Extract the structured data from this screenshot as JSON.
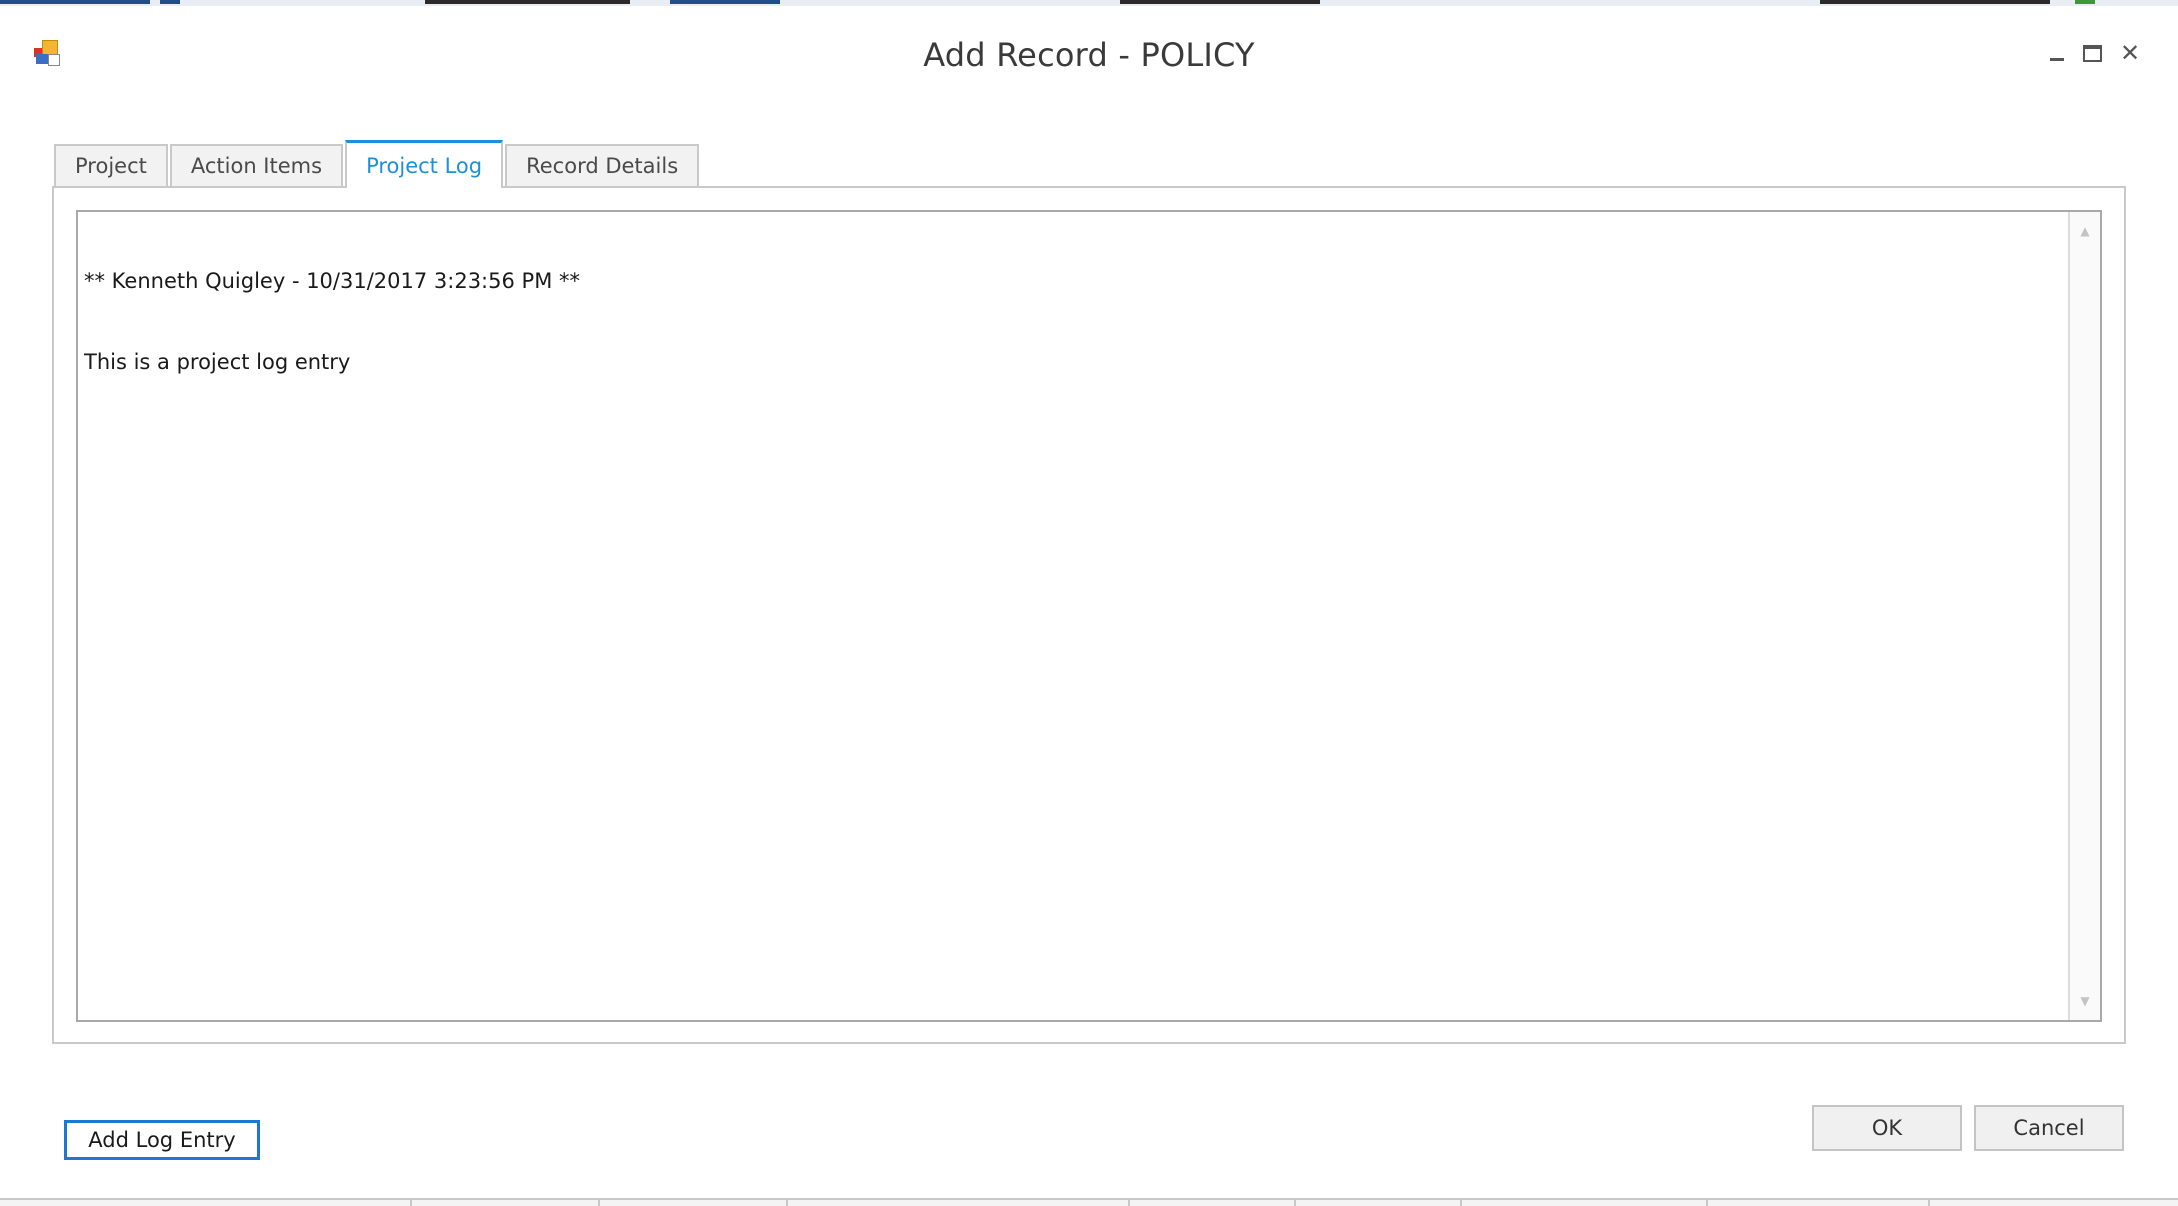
{
  "window": {
    "title": "Add Record - POLICY",
    "icon": "app-form-icon",
    "controls": {
      "minimize": "minimize-icon",
      "maximize": "maximize-icon",
      "close": "close-icon"
    }
  },
  "tabs": [
    {
      "label": "Project",
      "active": false
    },
    {
      "label": "Action Items",
      "active": false
    },
    {
      "label": "Project Log",
      "active": true
    },
    {
      "label": "Record Details",
      "active": false
    }
  ],
  "log": {
    "lines": [
      "** Kenneth Quigley - 10/31/2017 3:23:56 PM **",
      "This is a project log entry"
    ]
  },
  "buttons": {
    "add_log_entry": "Add Log Entry",
    "ok": "OK",
    "cancel": "Cancel"
  },
  "colors": {
    "accent": "#1e90d6",
    "focus_border": "#1e78d2"
  }
}
